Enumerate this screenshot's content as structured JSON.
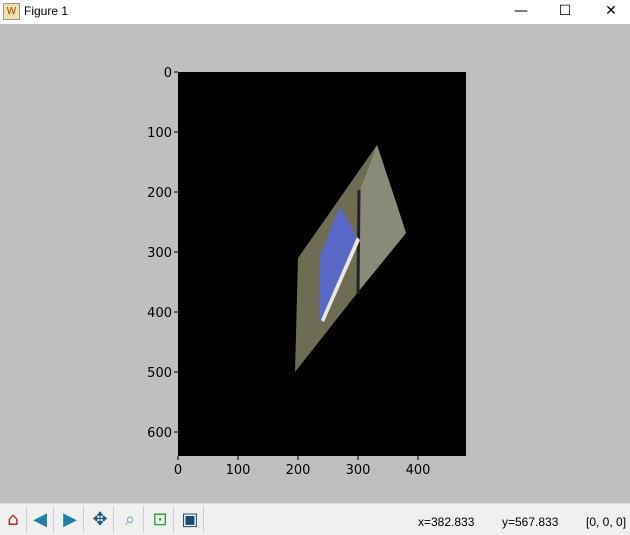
{
  "window": {
    "title": "Figure 1",
    "minimize": "—",
    "maximize": "☐",
    "close": "✕"
  },
  "axes": {
    "xticks": [
      "0",
      "100",
      "200",
      "300",
      "400"
    ],
    "yticks": [
      "0",
      "100",
      "200",
      "300",
      "400",
      "500",
      "600"
    ]
  },
  "toolbar": {
    "home": "home-icon",
    "back": "back-icon",
    "forward": "forward-icon",
    "pan": "pan-icon",
    "zoom": "zoom-icon",
    "subplots": "subplots-icon",
    "save": "save-icon"
  },
  "status": {
    "x": "x=382.833",
    "y": "y=567.833",
    "pixel": "[0, 0, 0]"
  }
}
